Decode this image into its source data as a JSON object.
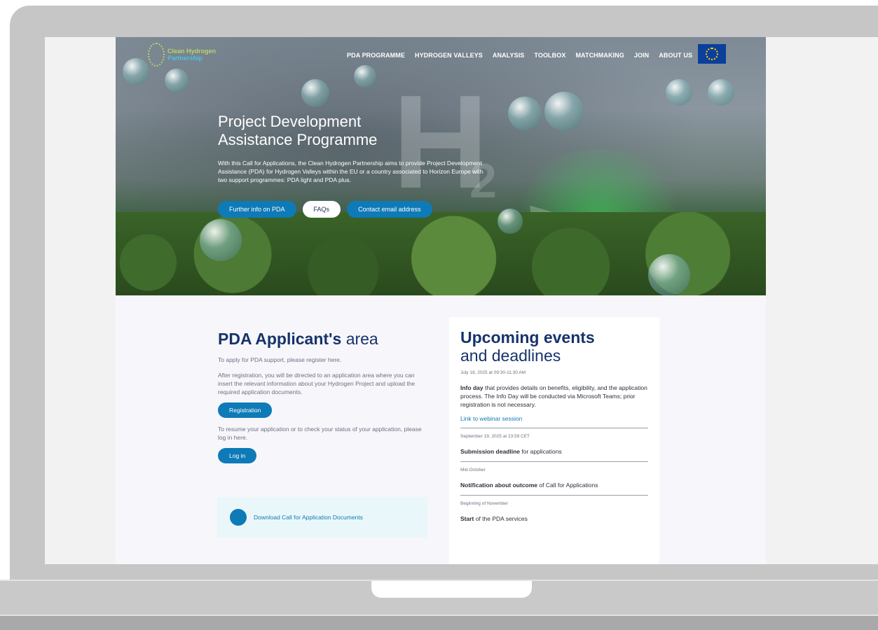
{
  "logo": {
    "line1": "Clean Hydrogen",
    "line2": "Partnership"
  },
  "nav": {
    "items": [
      "PDA PROGRAMME",
      "HYDROGEN VALLEYS",
      "ANALYSIS",
      "TOOLBOX",
      "MATCHMAKING",
      "JOIN",
      "ABOUT US"
    ]
  },
  "hero": {
    "title_line1": "Project Development",
    "title_line2": "Assistance Programme",
    "description": "With this Call for Applications, the Clean Hydrogen Partnership aims to provide Project Development Assistance (PDA) for Hydrogen Valleys within the EU or a country associated to Horizon Europe with two support programmes: PDA light and PDA plus.",
    "buttons": {
      "further_info": "Further info on PDA",
      "faqs": "FAQs",
      "contact": "Contact email address"
    }
  },
  "applicant": {
    "title_bold": "PDA Applicant's",
    "title_rest": "area",
    "intro": "To apply for PDA support, please register here.",
    "after_registration": "After registration, you will be directed to an application area where you can insert the relevant information about your Hydrogen Project and upload the required application documents.",
    "registration_button": "Registration",
    "resume_text": "To resume your application or to check your status of your application, please log in here.",
    "login_button": "Log in",
    "download_label": "Download Call for Application Documents"
  },
  "events": {
    "title_line1": "Upcoming events",
    "title_line2": "and deadlines",
    "items": [
      {
        "date": "July 18, 2025 at 09:30-11:30 AM",
        "bold": "Info day",
        "text": " that provides details on benefits, eligibility, and the application process. The Info Day will be conducted via Microsoft Teams; prior registration is not necessary.",
        "link": "Link to webinar session"
      },
      {
        "date": "September 19, 2025 at 23:59 CET",
        "bold": "Submission deadline",
        "text": " for applications"
      },
      {
        "date": "Mid-October",
        "bold": "Notification about outcome",
        "text": " of Call for Applications"
      },
      {
        "date": "Beginning of November",
        "bold": "Start",
        "text": " of the PDA services"
      }
    ]
  },
  "colors": {
    "primary": "#0e7ab7",
    "navy": "#16336b",
    "eu_blue": "#0b3f9c"
  }
}
